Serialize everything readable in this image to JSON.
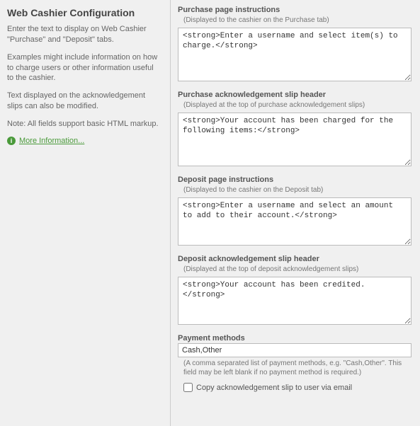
{
  "sidebar": {
    "title": "Web Cashier Configuration",
    "para1": "Enter the text to display on Web Cashier \"Purchase\" and \"Deposit\" tabs.",
    "para2": "Examples might include information on how to charge users or other information useful to the cashier.",
    "para3": "Text displayed on the acknowledgement slips can also be modified.",
    "para4": "Note: All fields support basic HTML markup.",
    "more_link": "More Information..."
  },
  "fields": {
    "purchase_instructions": {
      "label": "Purchase page instructions",
      "hint": "(Displayed to the cashier on the Purchase tab)",
      "value": "<strong>Enter a username and select item(s) to charge.</strong>"
    },
    "purchase_ack": {
      "label": "Purchase acknowledgement slip header",
      "hint": "(Displayed at the top of purchase acknowledgement slips)",
      "value": "<strong>Your account has been charged for the following items:</strong>"
    },
    "deposit_instructions": {
      "label": "Deposit page instructions",
      "hint": "(Displayed to the cashier on the Deposit tab)",
      "value": "<strong>Enter a username and select an amount to add to their account.</strong>"
    },
    "deposit_ack": {
      "label": "Deposit acknowledgement slip header",
      "hint": "(Displayed at the top of deposit acknowledgement slips)",
      "value": "<strong>Your account has been credited.</strong>"
    },
    "payment_methods": {
      "label": "Payment methods",
      "value": "Cash,Other",
      "hint": "(A comma separated list of payment methods, e.g. \"Cash,Other\". This field may be left blank if no payment method is required.)"
    },
    "copy_ack": {
      "label": "Copy acknowledgement slip to user via email",
      "checked": false
    }
  }
}
